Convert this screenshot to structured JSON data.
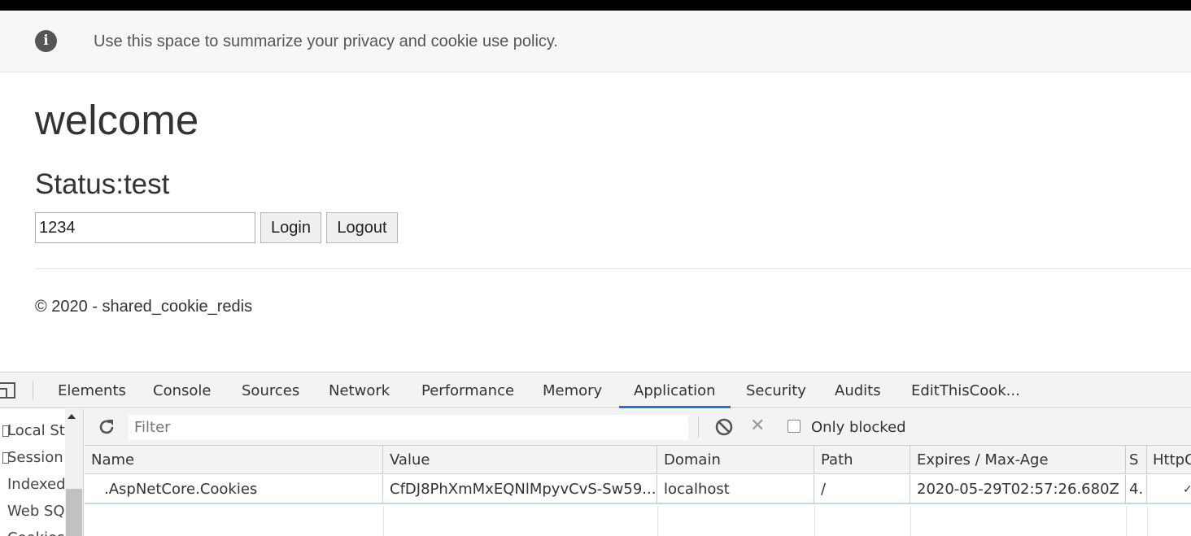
{
  "banner": {
    "text": "Use this space to summarize your privacy and cookie use policy.",
    "icon": "info-icon",
    "icon_glyph": "i"
  },
  "page": {
    "heading": "welcome",
    "status": "Status:test",
    "userid_value": "1234",
    "login_label": "Login",
    "logout_label": "Logout",
    "footer": "© 2020 - shared_cookie_redis"
  },
  "devtools": {
    "tabs": [
      "Elements",
      "Console",
      "Sources",
      "Network",
      "Performance",
      "Memory",
      "Application",
      "Security",
      "Audits",
      "EditThisCook..."
    ],
    "active_tab": "Application",
    "accent_color": "#1a73e8",
    "sidebar": [
      "Local Sto",
      "Session",
      "Indexed",
      "Web SQ",
      "Cookies"
    ],
    "filter_placeholder": "Filter",
    "only_blocked_label": "Only blocked",
    "only_blocked_checked": false,
    "columns": [
      "Name",
      "Value",
      "Domain",
      "Path",
      "Expires / Max-Age",
      "S",
      "HttpO"
    ],
    "rows": [
      {
        "name": ".AspNetCore.Cookies",
        "value": "CfDJ8PhXmMxEQNlMpyvCvS-Sw59...",
        "domain": "localhost",
        "path": "/",
        "expires": "2020-05-29T02:57:26.680Z",
        "size": "4.",
        "httponly": "✓"
      }
    ]
  }
}
